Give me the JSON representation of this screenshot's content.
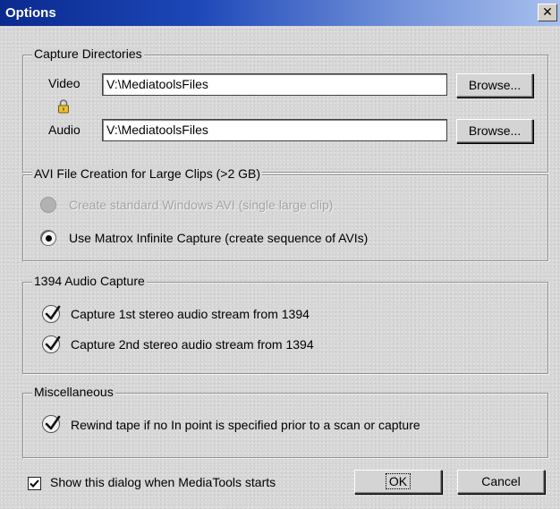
{
  "window": {
    "title": "Options",
    "close_glyph": "✕"
  },
  "capture_directories": {
    "label": "Capture Directories",
    "video_label": "Video",
    "video_value": "V:\\MediatoolsFiles",
    "audio_label": "Audio",
    "audio_value": "V:\\MediatoolsFiles",
    "browse_label": "Browse...",
    "lock_icon": "lock-icon"
  },
  "avi_creation": {
    "label": "AVI File Creation for Large Clips (>2 GB)",
    "option_standard": "Create standard Windows AVI (single large clip)",
    "option_standard_enabled": false,
    "option_matrox": "Use Matrox Infinite Capture (create sequence of AVIs)",
    "selected": "option_matrox"
  },
  "audio_capture": {
    "label": "1394 Audio Capture",
    "stream1": "Capture 1st stereo audio stream from 1394",
    "stream1_checked": true,
    "stream2": "Capture 2nd stereo audio stream from 1394",
    "stream2_checked": true
  },
  "misc": {
    "label": "Miscellaneous",
    "rewind": "Rewind tape if no In point is specified prior to a scan or capture",
    "rewind_checked": true
  },
  "footer": {
    "show_dialog": "Show this dialog when MediaTools starts",
    "show_dialog_checked": true,
    "ok_label": "OK",
    "cancel_label": "Cancel"
  },
  "colors": {
    "title_bar_start": "#0a2a8e",
    "title_bar_end": "#a9c0ee",
    "dialog_face": "#d6d6d6"
  }
}
